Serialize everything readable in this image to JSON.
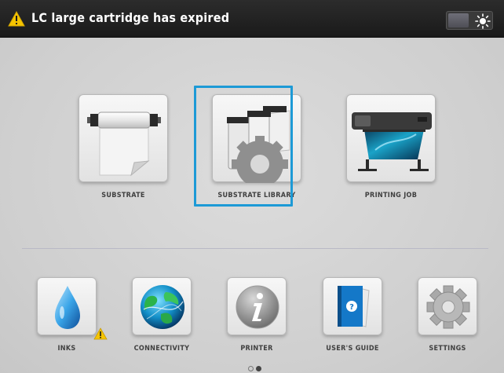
{
  "header": {
    "alert_title": "LC large cartridge has expired",
    "warning_icon": "warning-triangle-icon",
    "brightness_icon": "sun-icon"
  },
  "top_row": [
    {
      "label": "SUBSTRATE",
      "icon": "substrate-roll-icon"
    },
    {
      "label": "SUBSTRATE LIBRARY",
      "icon": "substrate-library-icon",
      "selected": true
    },
    {
      "label": "PRINTING JOB",
      "icon": "large-format-printer-icon"
    }
  ],
  "bottom_row": [
    {
      "label": "INKS",
      "icon": "ink-drop-icon",
      "badge": "warning-triangle-icon"
    },
    {
      "label": "CONNECTIVITY",
      "icon": "globe-icon"
    },
    {
      "label": "PRINTER",
      "icon": "info-icon"
    },
    {
      "label": "USER'S GUIDE",
      "icon": "book-icon"
    },
    {
      "label": "SETTINGS",
      "icon": "gear-icon"
    }
  ],
  "pager": {
    "pages": 2,
    "current": 2
  },
  "colors": {
    "selection": "#1d9ad6",
    "warning": "#f5c400",
    "header_bg": "#222222"
  }
}
